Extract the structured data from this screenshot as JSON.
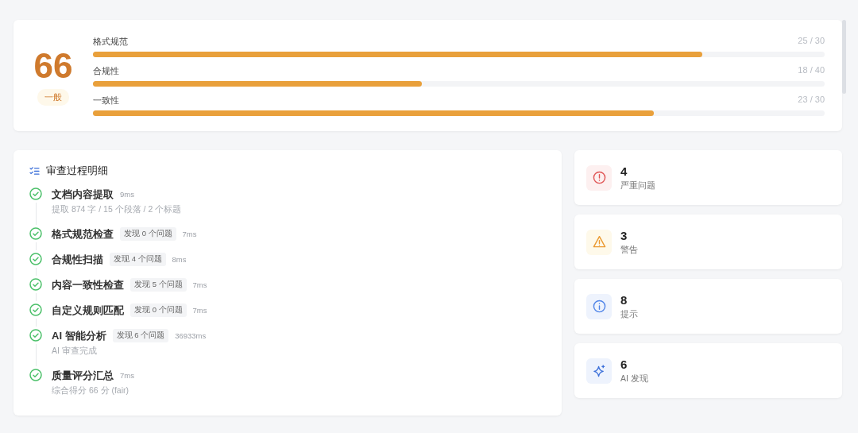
{
  "score": {
    "value": "66",
    "grade": "一般"
  },
  "metrics": [
    {
      "label": "格式规范",
      "reading": "25 / 30",
      "level": 0.833
    },
    {
      "label": "合规性",
      "reading": "18 / 40",
      "level": 0.45
    },
    {
      "label": "一致性",
      "reading": "23 / 30",
      "level": 0.767
    }
  ],
  "process": {
    "title": "审查过程明细",
    "steps": [
      {
        "name": "文档内容提取",
        "time": "9ms",
        "detail": "提取 874 字 / 15 个段落 / 2 个标题"
      },
      {
        "name": "格式规范检查",
        "tag": "发现 0 个问题",
        "time": "7ms"
      },
      {
        "name": "合规性扫描",
        "tag": "发现 4 个问题",
        "time": "8ms"
      },
      {
        "name": "内容一致性检查",
        "tag": "发现 5 个问题",
        "time": "7ms"
      },
      {
        "name": "自定义规则匹配",
        "tag": "发现 0 个问题",
        "time": "7ms"
      },
      {
        "name": "AI 智能分析",
        "tag": "发现 6 个问题",
        "time": "36933ms",
        "detail": "AI 审查完成"
      },
      {
        "name": "质量评分汇总",
        "time": "7ms",
        "detail": "综合得分 66 分 (fair)"
      }
    ]
  },
  "stats": [
    {
      "kind": "critical",
      "count": "4",
      "label": "严重问题"
    },
    {
      "kind": "warning",
      "count": "3",
      "label": "警告"
    },
    {
      "kind": "info",
      "count": "8",
      "label": "提示"
    },
    {
      "kind": "ai",
      "count": "6",
      "label": "AI 发现"
    }
  ]
}
